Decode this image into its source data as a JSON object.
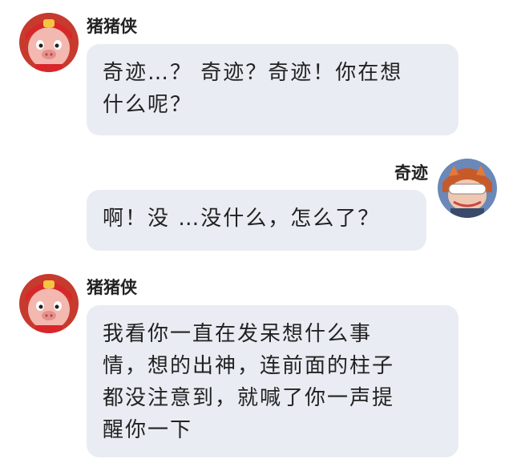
{
  "messages": [
    {
      "sender": "猪猪侠",
      "side": "left",
      "avatar_icon": "zhuzhuxia-avatar-icon",
      "lines": [
        "奇迹…？ 奇迹？奇迹！你在想",
        "什么呢？"
      ]
    },
    {
      "sender": "奇迹",
      "side": "right",
      "avatar_icon": "qiji-avatar-icon",
      "lines": [
        "啊！没 …没什么，怎么了？"
      ]
    },
    {
      "sender": "猪猪侠",
      "side": "left",
      "avatar_icon": "zhuzhuxia-avatar-icon",
      "lines": [
        "我看你一直在发呆想什么事",
        "情，想的出神，连前面的柱子",
        "都没注意到，就喊了你一声提",
        "醒你一下"
      ]
    }
  ],
  "colors": {
    "bubble": "#e9ecf2",
    "text": "#222222",
    "avatar_pig_face": "#f3b8b0",
    "avatar_pig_helmet": "#d8262a",
    "avatar_qiji_hair": "#c85a2a",
    "avatar_qiji_background": "#6a88b8"
  }
}
